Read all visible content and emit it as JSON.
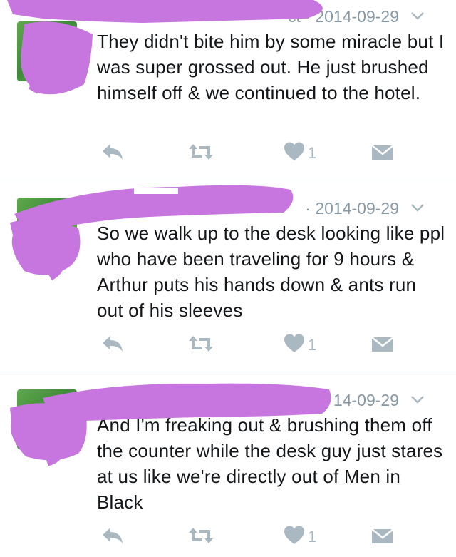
{
  "tweets": [
    {
      "meta_visible": "ct · 2014-09-29",
      "text": "They didn't bite him by some miracle but I was super grossed out. He just brushed himself off & we continued to the hotel.",
      "likes": "1"
    },
    {
      "meta_visible": "· 2014-09-29",
      "text": "So we walk up to the desk looking like ppl who have been traveling for 9 hours & Arthur puts his hands down & ants run out of his sleeves",
      "likes": "1"
    },
    {
      "meta_visible": "14-09-29",
      "text": "And I'm freaking out & brushing them off the counter while the desk guy just stares at us like we're directly out of Men in Black",
      "likes": "1"
    }
  ],
  "icons": {
    "reply": "reply-icon",
    "retweet": "retweet-icon",
    "like": "heart-icon",
    "message": "envelope-icon",
    "more": "chevron-down-icon"
  },
  "colors": {
    "icon_gray": "#aab8c2",
    "meta_gray": "#8899a6",
    "text": "#14171a",
    "divider": "#e1e8ed",
    "redaction": "#c776e0"
  }
}
